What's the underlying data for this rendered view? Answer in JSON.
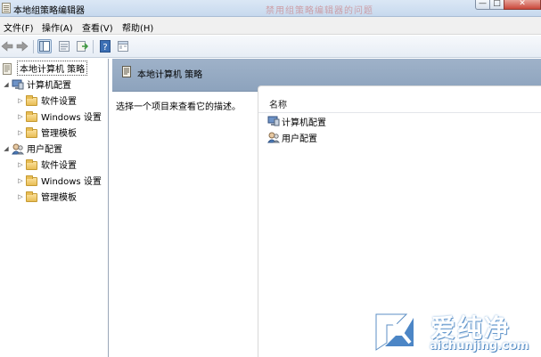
{
  "window": {
    "title": "本地组策略编辑器",
    "watermark_title": "禁用组策略编辑器的问题",
    "min_icon": "minimize-icon",
    "max_icon": "maximize-icon",
    "close_icon": "close-icon"
  },
  "menu": {
    "file": "文件(F)",
    "action": "操作(A)",
    "view": "查看(V)",
    "help": "帮助(H)"
  },
  "toolbar": {
    "icons": [
      "back-arrow-icon",
      "forward-arrow-icon",
      "show-tree-icon",
      "properties-icon",
      "export-icon",
      "help-icon",
      "extended-view-icon"
    ]
  },
  "tree": {
    "root": "本地计算机 策略",
    "computer_config": "计算机配置",
    "computer_children": [
      "软件设置",
      "Windows 设置",
      "管理模板"
    ],
    "user_config": "用户配置",
    "user_children": [
      "软件设置",
      "Windows 设置",
      "管理模板"
    ]
  },
  "detail": {
    "header_title": "本地计算机 策略",
    "description": "选择一个项目来查看它的描述。",
    "column_name": "名称",
    "items": [
      "计算机配置",
      "用户配置"
    ]
  },
  "logo": {
    "text": "爱纯净",
    "domain": "aichunjing.com"
  },
  "colors": {
    "header_band": "#9fb2c9",
    "folder": "#e8bd55"
  }
}
